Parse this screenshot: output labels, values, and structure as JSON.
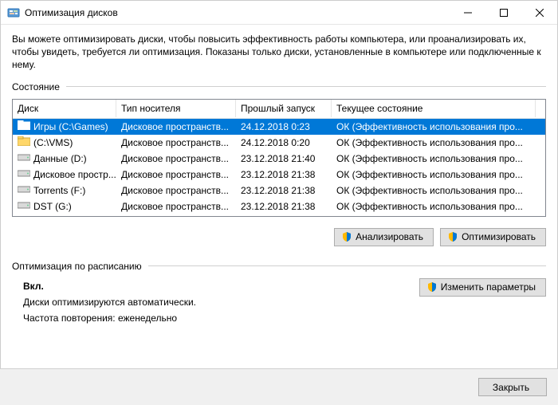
{
  "window": {
    "title": "Оптимизация дисков"
  },
  "intro": "Вы можете оптимизировать диски, чтобы повысить эффективность работы  компьютера, или проанализировать их, чтобы увидеть, требуется ли оптимизация. Показаны только диски, установленные в компьютере или подключенные к нему.",
  "status_label": "Состояние",
  "columns": {
    "disk": "Диск",
    "type": "Тип носителя",
    "last": "Прошлый запуск",
    "status": "Текущее состояние"
  },
  "drives": [
    {
      "name": "Игры (C:\\Games)",
      "type": "Дисковое пространств...",
      "last": "24.12.2018 0:23",
      "status": "ОК (Эффективность использования про...",
      "icon": "folder",
      "selected": true
    },
    {
      "name": "(C:\\VMS)",
      "type": "Дисковое пространств...",
      "last": "24.12.2018 0:20",
      "status": "ОК (Эффективность использования про...",
      "icon": "folder",
      "selected": false
    },
    {
      "name": "Данные (D:)",
      "type": "Дисковое пространств...",
      "last": "23.12.2018 21:40",
      "status": "ОК (Эффективность использования про...",
      "icon": "drive",
      "selected": false
    },
    {
      "name": "Дисковое простр...",
      "type": "Дисковое пространств...",
      "last": "23.12.2018 21:38",
      "status": "ОК (Эффективность использования про...",
      "icon": "drive",
      "selected": false
    },
    {
      "name": "Torrents (F:)",
      "type": "Дисковое пространств...",
      "last": "23.12.2018 21:38",
      "status": "ОК (Эффективность использования про...",
      "icon": "drive",
      "selected": false
    },
    {
      "name": "DST (G:)",
      "type": "Дисковое пространств...",
      "last": "23.12.2018 21:38",
      "status": "ОК (Эффективность использования про...",
      "icon": "drive",
      "selected": false
    }
  ],
  "buttons": {
    "analyze": "Анализировать",
    "optimize": "Оптимизировать",
    "change": "Изменить параметры",
    "close": "Закрыть"
  },
  "schedule": {
    "label": "Оптимизация по расписанию",
    "state": "Вкл.",
    "line1": "Диски оптимизируются автоматически.",
    "line2": "Частота повторения: еженедельно"
  }
}
